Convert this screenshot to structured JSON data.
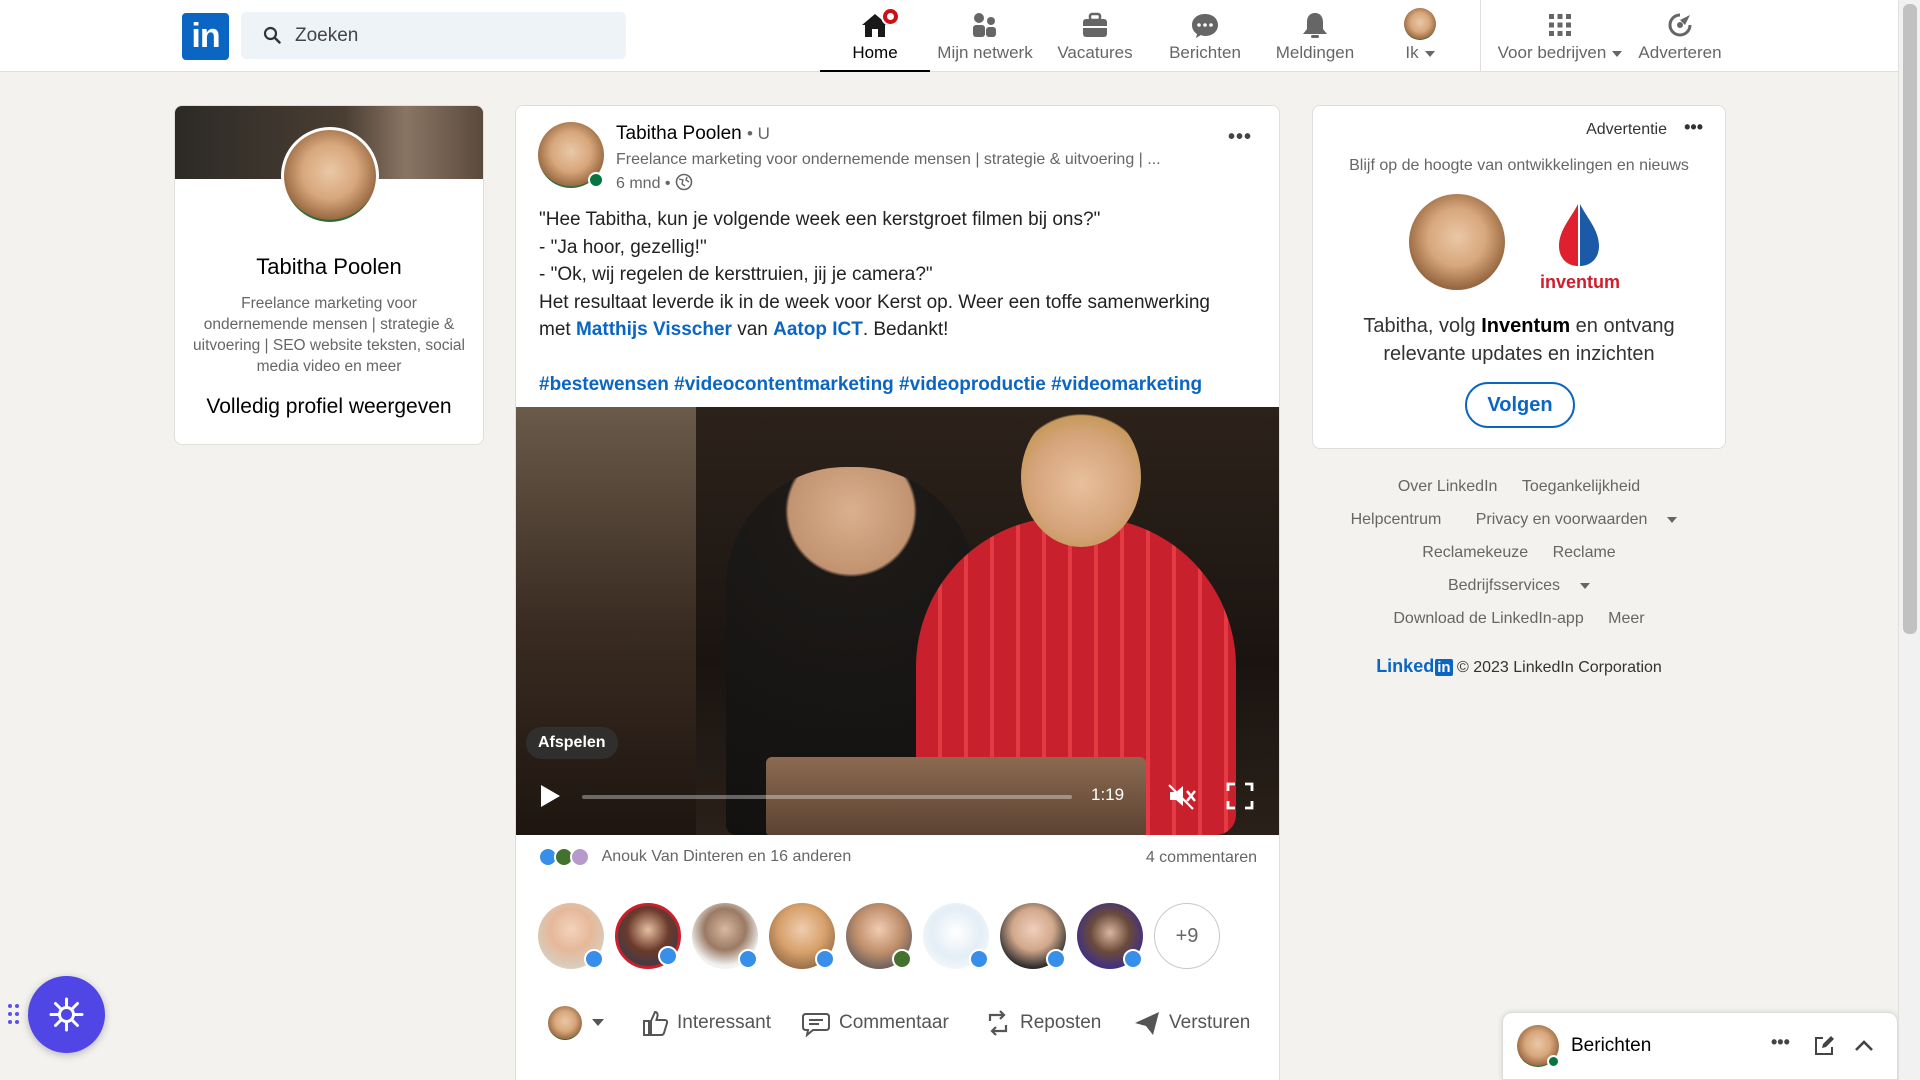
{
  "nav": {
    "logo": "in",
    "search_placeholder": "Zoeken",
    "items": [
      {
        "label": "Home",
        "icon": "home-icon",
        "active": true
      },
      {
        "label": "Mijn netwerk",
        "icon": "network-icon"
      },
      {
        "label": "Vacatures",
        "icon": "briefcase-icon"
      },
      {
        "label": "Berichten",
        "icon": "messaging-icon"
      },
      {
        "label": "Meldingen",
        "icon": "bell-icon"
      },
      {
        "label": "Ik",
        "icon": "avatar-icon"
      },
      {
        "label": "Voor bedrijven",
        "icon": "grid-icon"
      },
      {
        "label": "Adverteren",
        "icon": "advertise-icon"
      }
    ]
  },
  "profile": {
    "name": "Tabitha Poolen",
    "description": "Freelance marketing voor ondernemende mensen | strategie & uitvoering | SEO website teksten, social media video en meer",
    "view_link": "Volledig profiel weergeven"
  },
  "post": {
    "author": "Tabitha Poolen",
    "degree": "• U",
    "headline": "Freelance marketing voor ondernemende mensen | strategie & uitvoering | ...",
    "time": "6 mnd •",
    "more": "•••",
    "lines": [
      "\"Hee Tabitha, kun je volgende week een kerstgroet filmen bij ons?\"",
      "- \"Ja hoor, gezellig!\"",
      "- \"Ok, wij regelen de kersttruien, jij je camera?\"",
      "Het resultaat leverde ik in de week voor Kerst op. Weer een toffe samenwerking"
    ],
    "line5_pre": "met",
    "mention1": "Matthijs Visscher",
    "line5_mid": "van",
    "mention2": "Aatop ICT",
    "line5_post": ". Bedankt!",
    "hashtags": "#bestewensen #videocontentmarketing #videoproductie #videomarketing",
    "video": {
      "play_label": "Afspelen",
      "duration": "1:19",
      "progress": 0
    },
    "reactions_text": "Anouk Van Dinteren en 16 anderen",
    "comments_text": "4 commentaren",
    "more_likers": "+9",
    "actions": {
      "like": "Interessant",
      "comment": "Commentaar",
      "repost": "Reposten",
      "send": "Versturen"
    }
  },
  "ad": {
    "label": "Advertentie",
    "more": "•••",
    "tagline": "Blijf op de hoogte van ontwikkelingen en nieuws",
    "brand": "inventum",
    "copy_pre": "Tabitha, volg",
    "copy_brand": "Inventum",
    "copy_post": "en ontvang relevante updates en inzichten",
    "button": "Volgen"
  },
  "footer": {
    "row1": [
      "Over LinkedIn",
      "Toegankelijkheid"
    ],
    "row2": [
      "Helpcentrum",
      "Privacy en voorwaarden"
    ],
    "row3": [
      "Reclamekeuze",
      "Reclame"
    ],
    "row4": [
      "Bedrijfsservices"
    ],
    "row5": [
      "Download de LinkedIn-app",
      "Meer"
    ],
    "brand_text": "Linked",
    "brand_in": "in",
    "copyright": "© 2023 LinkedIn Corporation"
  },
  "messaging": {
    "title": "Berichten",
    "more": "•••"
  },
  "colors": {
    "brand": "#0a66c2",
    "background": "#f3f2ef",
    "notification": "#cc1016",
    "online": "#057642",
    "assistant": "#4f46e5"
  }
}
